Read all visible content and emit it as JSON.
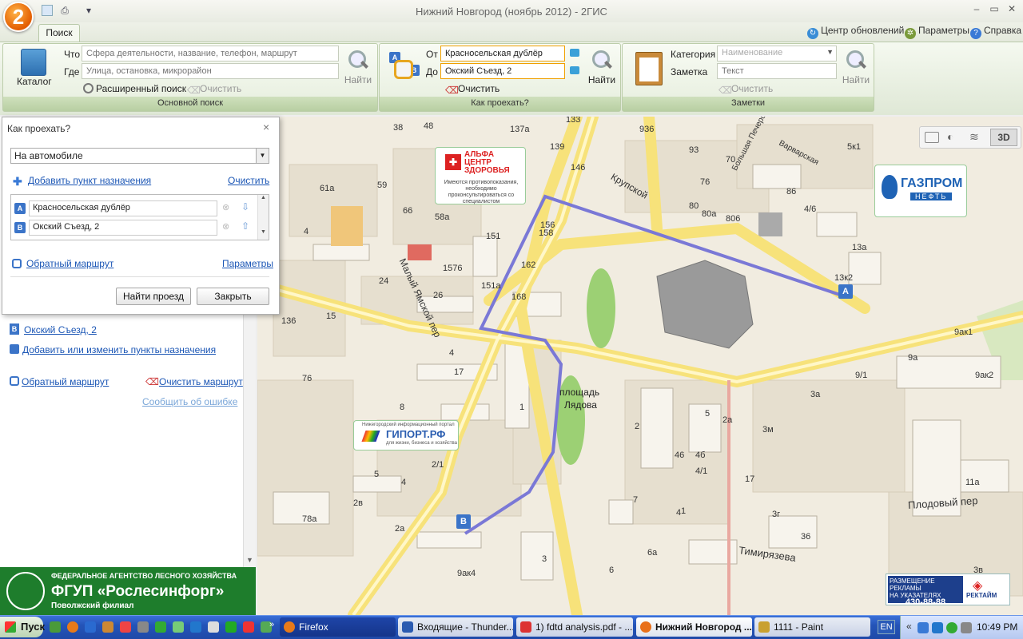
{
  "window": {
    "title": "Нижний Новгород (ноябрь 2012) -  2ГИС",
    "logo": "2"
  },
  "ribbon": {
    "tab": "Поиск",
    "top_links": {
      "updates": "Центр обновлений",
      "params": "Параметры",
      "help": "Справка"
    },
    "basic_search": {
      "catalog": "Каталог",
      "what_label": "Что",
      "what_placeholder": "Сфера деятельности, название, телефон, маршрут",
      "where_label": "Где",
      "where_placeholder": "Улица, остановка, микрорайон",
      "advanced": "Расширенный поиск",
      "clear": "Очистить",
      "find": "Найти",
      "footer": "Основной поиск"
    },
    "route": {
      "from_label": "От",
      "from_value": "Красносельская дублёр",
      "to_label": "До",
      "to_value": "Окский Съезд, 2",
      "clear": "Очистить",
      "find": "Найти",
      "footer": "Как проехать?"
    },
    "notes": {
      "category_label": "Категория",
      "category_placeholder": "Наименование",
      "note_label": "Заметка",
      "note_placeholder": "Текст",
      "clear": "Очистить",
      "find": "Найти",
      "footer": "Заметки"
    }
  },
  "dialog": {
    "title": "Как проехать?",
    "mode": "На автомобиле",
    "add_destination": "Добавить пункт назначения",
    "clear": "Очистить",
    "points": [
      {
        "marker": "A",
        "value": "Красносельская дублёр"
      },
      {
        "marker": "B",
        "value": "Окский Съезд, 2"
      }
    ],
    "reverse": "Обратный маршрут",
    "params": "Параметры",
    "find_route": "Найти проезд",
    "close": "Закрыть"
  },
  "panel": {
    "point_b_marker": "B",
    "point_b_link": "Окский Съезд, 2",
    "edit_points": "Добавить или изменить пункты назначения",
    "reverse": "Обратный маршрут",
    "clear_route": "Очистить маршрут",
    "report_error": "Сообщить об ошибке"
  },
  "ad": {
    "line1": "ФЕДЕРАЛЬНОЕ АГЕНТСТВО ЛЕСНОГО ХОЗЯЙСТВА",
    "line2": "ФГУП «Рослесинфорг»",
    "line3": "Поволжский филиал"
  },
  "map": {
    "mode_3d": "3D",
    "square_name_1": "площадь",
    "square_name_2": "Лядова",
    "streets": {
      "krupskoy": "Крупской",
      "maly_yamskoy": "Малый Ямской пер",
      "plodovy": "Плодовый пер",
      "timiryazeva": "Тимирязева",
      "bolshaya": "Большая Печерская",
      "varvarskaya": "Варварская"
    },
    "ad_alfa": {
      "line1": "АЛЬФА",
      "line2": "ЦЕНТР",
      "line3": "ЗДОРОВЬЯ",
      "small": "Имеются противопоказания, необходимо проконсультироваться со специалистом"
    },
    "ad_gazprom": {
      "line1": "ГАЗПРОМ",
      "line2": "НЕФТЬ"
    },
    "ad_giport": {
      "top": "Нижегородский информационный портал",
      "name": "ГИПОРТ.РФ",
      "sub": "для жизни, бизнеса и хозяйства"
    },
    "ad_rektaim": {
      "line1": "РАЗМЕЩЕНИЕ РЕКЛАМЫ",
      "line2": "НА УКАЗАТЕЛЯХ",
      "phone": "430-88-88",
      "brand": "РЕКТАЙМ"
    },
    "route_a": "A",
    "route_b": "B",
    "house_numbers": [
      "38",
      "48",
      "137а",
      "133",
      "139",
      "146",
      "936",
      "93",
      "70",
      "5к1",
      "61а",
      "59",
      "66",
      "58а",
      "4",
      "151",
      "156",
      "158",
      "162",
      "80",
      "80а",
      "806",
      "76",
      "86",
      "4/6",
      "13а",
      "13к2",
      "1576",
      "24",
      "26",
      "151а",
      "168",
      "15",
      "136",
      "17",
      "76",
      "8",
      "1",
      "9/1",
      "9а",
      "9ак1",
      "9ак2",
      "3а",
      "3м",
      "2",
      "46",
      "4б",
      "4/1",
      "2а",
      "5",
      "4",
      "2/1",
      "2в",
      "78а",
      "2а",
      "3",
      "6а",
      "6",
      "4",
      "3г",
      "36",
      "3в",
      "11а",
      "17",
      "9ак4",
      "7",
      "1",
      "4",
      "5",
      "2"
    ]
  },
  "taskbar": {
    "start": "Пуск",
    "tasks": [
      "Firefox",
      "Входящие - Thunder...",
      "1) fdtd analysis.pdf - ...",
      "Нижний Новгород ...",
      "1111 - Paint"
    ],
    "lang": "EN",
    "clock": "10:49 PM"
  }
}
